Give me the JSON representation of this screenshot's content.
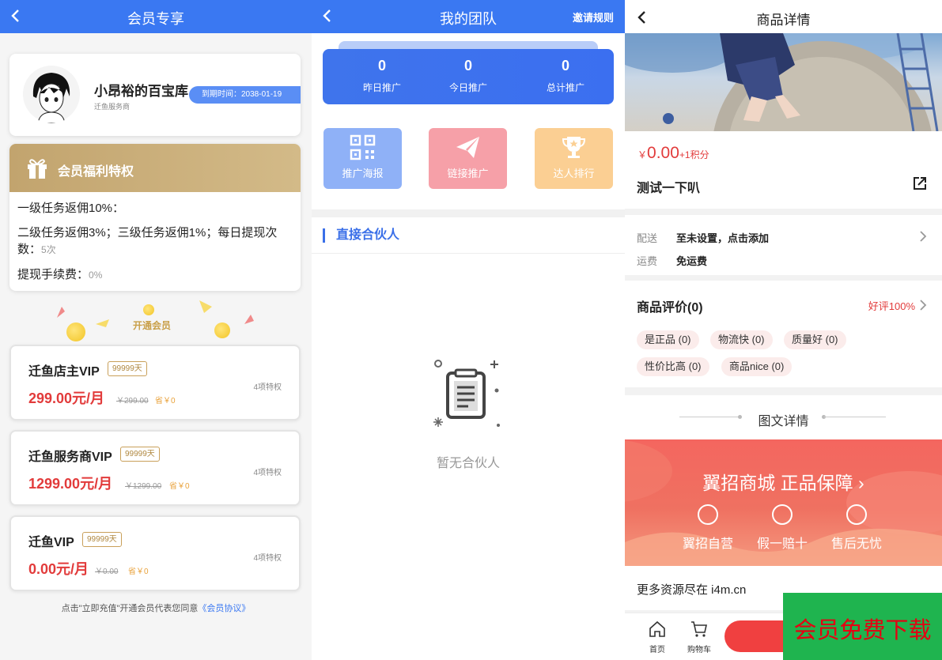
{
  "panel1": {
    "nav_title": "会员专享",
    "profile": {
      "name": "小昂裕的百宝库",
      "sub": "迁鱼服务商",
      "expire": "到期时间：2038-01-19"
    },
    "benefits": {
      "title": "会员福利特权",
      "line1": "一级任务返佣10%：",
      "line2": "二级任务返佣3%；三级任务返佣1%；每日提现次数：",
      "line2_value": "5次",
      "line3": "提现手续费：",
      "line3_value": "0%"
    },
    "open_vip": "开通会员",
    "vips": [
      {
        "name": "迁鱼店主VIP",
        "days": "99999天",
        "price": "299.00元/月",
        "orig": "￥299.00",
        "save": "省￥0",
        "priv": "4项特权"
      },
      {
        "name": "迁鱼服务商VIP",
        "days": "99999天",
        "price": "1299.00元/月",
        "orig": "￥1299.00",
        "save": "省￥0",
        "priv": "4项特权"
      },
      {
        "name": "迁鱼VIP",
        "days": "99999天",
        "price": "0.00元/月",
        "orig": "￥0.00",
        "save": "省￥0",
        "priv": "4项特权"
      }
    ],
    "agree_text": "点击\"立即充值\"开通会员代表您同意",
    "agree_link": "《会员协议》"
  },
  "panel2": {
    "nav_title": "我的团队",
    "nav_right": "邀请规则",
    "stats": [
      {
        "value": "0",
        "label": "昨日推广"
      },
      {
        "value": "0",
        "label": "今日推广"
      },
      {
        "value": "0",
        "label": "总计推广"
      }
    ],
    "tiles": [
      {
        "label": "推广海报",
        "color": "#8fb1f7",
        "icon": "qrcode-icon"
      },
      {
        "label": "链接推广",
        "color": "#f6a0a8",
        "icon": "paper-plane-icon"
      },
      {
        "label": "达人排行",
        "color": "#fbcf93",
        "icon": "trophy-icon"
      }
    ],
    "section_title": "直接合伙人",
    "empty_text": "暂无合伙人"
  },
  "panel3": {
    "nav_title": "商品详情",
    "price": {
      "currency": "￥",
      "value": "0.00",
      "points": "+1积分"
    },
    "title": "测试一下叭",
    "shipping": {
      "delivery_label": "配送",
      "delivery_value": "至未设置，点击添加",
      "fee_label": "运费",
      "fee_value": "免运费"
    },
    "reviews": {
      "title": "商品评价(0)",
      "rate": "好评100%",
      "tags": [
        "是正品 (0)",
        "物流快 (0)",
        "质量好 (0)",
        "性价比高 (0)",
        "商品nice (0)"
      ]
    },
    "detail_title": "图文详情",
    "banner": {
      "title": "翼招商城 正品保障 ›",
      "items": [
        "翼招自营",
        "假一赔十",
        "售后无忧"
      ]
    },
    "more_text": "更多资源尽在 i4m.cn",
    "bottom": {
      "home": "首页",
      "cart": "购物车"
    },
    "promo": "会员免费下载"
  },
  "colors": {
    "primary_blue": "#3a78f2",
    "price_red": "#e23b3b",
    "gold": "#c2a46e",
    "promo_green": "#1fb44f"
  }
}
